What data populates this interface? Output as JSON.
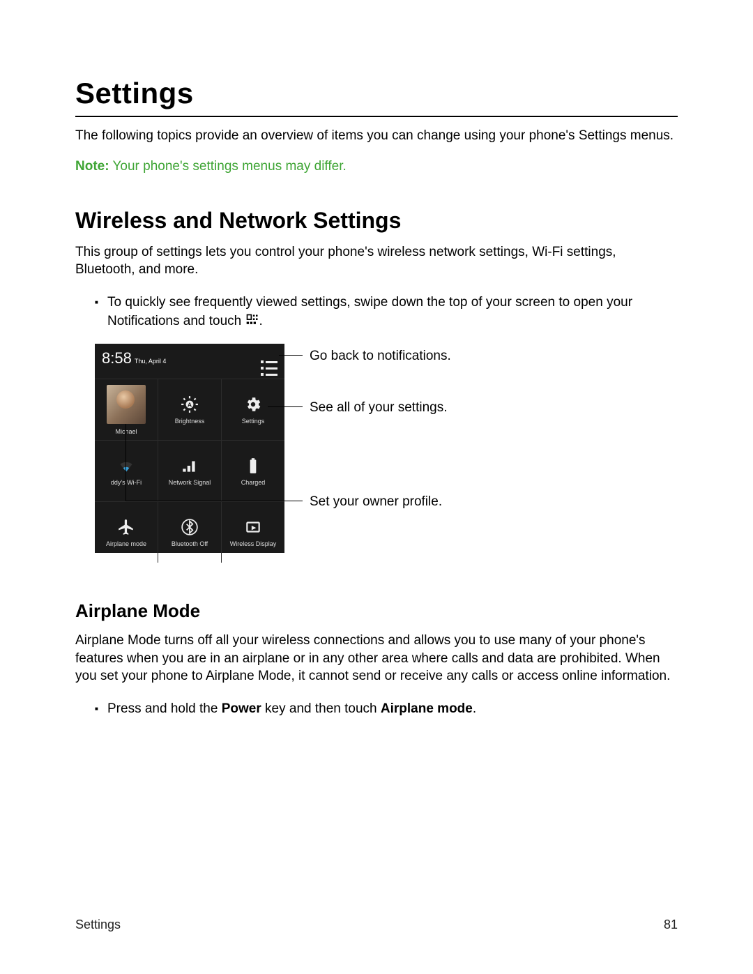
{
  "page_title": "Settings",
  "intro": "The following topics provide an overview of items you can change using your phone's Settings menus.",
  "note_label": "Note:",
  "note_text": " Your phone's settings menus may differ.",
  "section_wireless": "Wireless and Network Settings",
  "wireless_intro": "This group of settings lets you control your phone's wireless network settings, Wi-Fi settings, Bluetooth, and more.",
  "bullet_swipe_pre": "To quickly see frequently viewed settings, swipe down the top of your screen to open your Notifications and touch ",
  "bullet_swipe_post": ".",
  "phone": {
    "clock": "8:58",
    "date": "Thu, April 4",
    "tiles": [
      {
        "label": "Michael"
      },
      {
        "label": "Brightness"
      },
      {
        "label": "Settings"
      },
      {
        "label": "ddy's Wi-Fi"
      },
      {
        "label": "Network Signal"
      },
      {
        "label": "Charged"
      },
      {
        "label": "Airplane mode"
      },
      {
        "label": "Bluetooth Off"
      },
      {
        "label": "Wireless Display"
      }
    ]
  },
  "callouts": {
    "notif": "Go back to notifications.",
    "settings": "See all of your settings.",
    "owner": "Set your owner profile."
  },
  "section_airplane": "Airplane Mode",
  "airplane_body": "Airplane Mode turns off all your wireless connections and allows you to use many of your phone's features when you are in an airplane or in any other area where calls and data are prohibited. When you set your phone to Airplane Mode, it cannot send or receive any calls or access online information.",
  "airplane_bullet_pre": "Press and hold the ",
  "airplane_bullet_mid": " key and then touch ",
  "airplane_bullet_bold1": "Power",
  "airplane_bullet_bold2": "Airplane mode",
  "airplane_bullet_post": ".",
  "footer_left": "Settings",
  "footer_right": "81"
}
